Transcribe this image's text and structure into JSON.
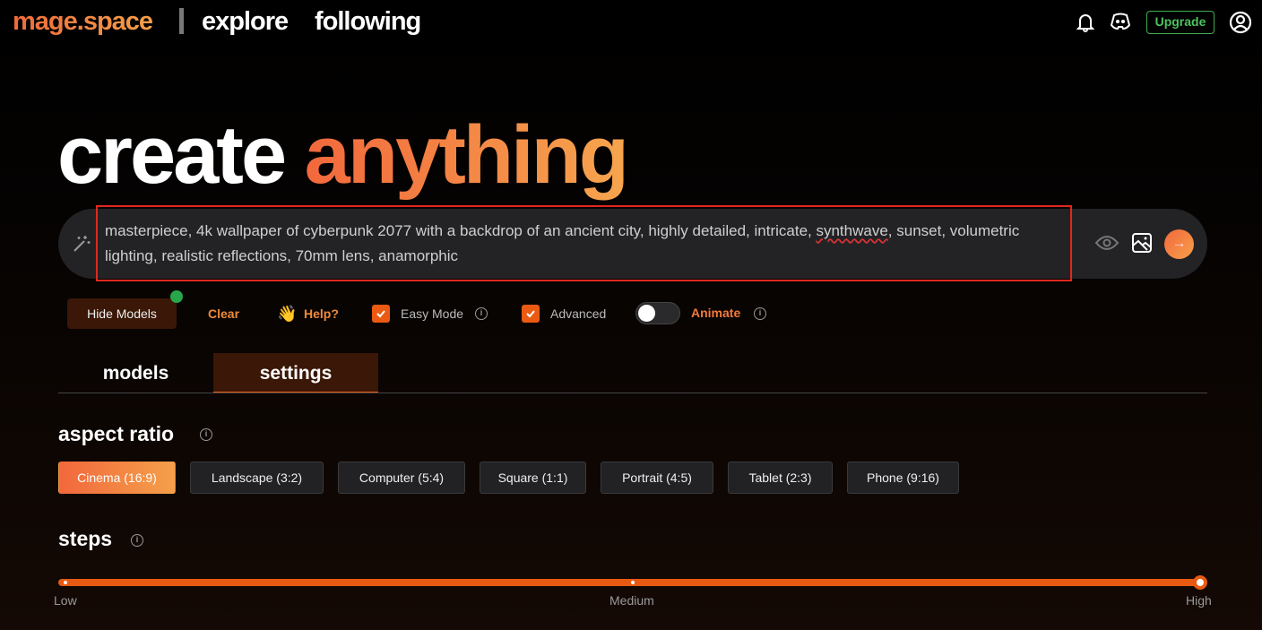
{
  "header": {
    "logo": "mage.space",
    "nav": [
      "explore",
      "following"
    ],
    "upgrade": "Upgrade",
    "accent": "#f06a3a"
  },
  "hero": {
    "title_white": "create",
    "title_accent": "anything"
  },
  "prompt": {
    "text_before": "masterpiece, 4k wallpaper of cyberpunk 2077 with a backdrop of an ancient city, highly detailed, intricate, ",
    "text_misspelled": "synthwave",
    "text_after": ", sunset, volumetric lighting, realistic reflections, 70mm lens, anamorphic"
  },
  "toolbar": {
    "hide_models": "Hide Models",
    "clear": "Clear",
    "help_emoji": "👋",
    "help": "Help?",
    "easy_mode": "Easy Mode",
    "easy_mode_checked": true,
    "advanced": "Advanced",
    "advanced_checked": true,
    "animate": "Animate",
    "animate_on": false
  },
  "tabs": [
    {
      "label": "models",
      "active": false
    },
    {
      "label": "settings",
      "active": true
    }
  ],
  "aspect": {
    "title": "aspect ratio",
    "options": [
      "Cinema (16:9)",
      "Landscape (3:2)",
      "Computer (5:4)",
      "Square (1:1)",
      "Portrait (4:5)",
      "Tablet (2:3)",
      "Phone (9:16)"
    ],
    "selected": "Cinema (16:9)"
  },
  "steps": {
    "title": "steps",
    "labels": [
      "Low",
      "Medium",
      "High"
    ],
    "value": "High"
  }
}
